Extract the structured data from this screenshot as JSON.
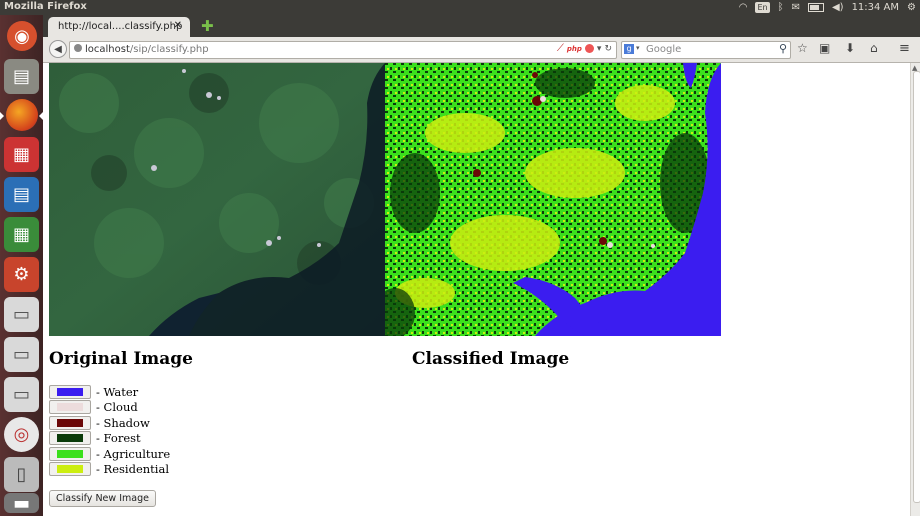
{
  "system": {
    "app_title": "Mozilla Firefox",
    "keyboard_layout": "En",
    "clock": "11:34 AM"
  },
  "browser": {
    "tab_title": "http://local....classify.php",
    "url_host": "localhost",
    "url_path": "/sip/classify.php",
    "search_placeholder": "Google",
    "php_badge": "php"
  },
  "page": {
    "original_caption": "Original Image",
    "classified_caption": "Classified Image",
    "legend": [
      {
        "label": "- Water",
        "color": "#3b1df0"
      },
      {
        "label": "- Cloud",
        "color": "#ecdcdc"
      },
      {
        "label": "- Shadow",
        "color": "#6a0707"
      },
      {
        "label": "- Forest",
        "color": "#0a3b0a"
      },
      {
        "label": "- Agriculture",
        "color": "#3be01c"
      },
      {
        "label": "- Residential",
        "color": "#ccee10"
      }
    ],
    "classify_button": "Classify New Image"
  },
  "colors": {
    "water": "#3b1df0",
    "forest_dark": "#0b2a12",
    "agriculture": "#3be01c",
    "residential": "#ccee10",
    "launcher": "#4a2b2b"
  }
}
